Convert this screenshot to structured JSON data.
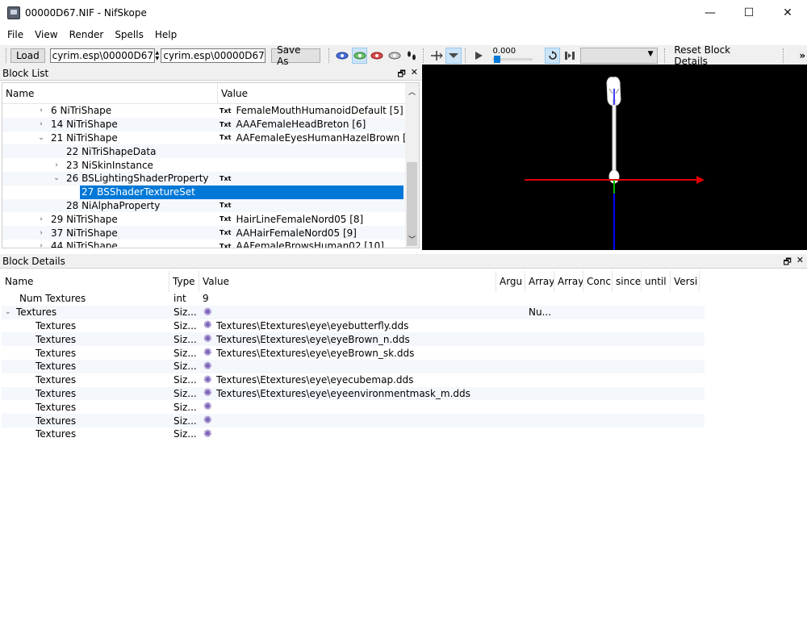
{
  "window": {
    "title": "00000D67.NIF - NifSkope",
    "minimize": "—",
    "maximize": "☐",
    "close": "✕"
  },
  "menu": [
    "File",
    "View",
    "Render",
    "Spells",
    "Help"
  ],
  "toolbar": {
    "load_label": "Load",
    "load_path": "cyrim.esp\\00000D67.NIF",
    "save_path": "cyrim.esp\\00000D67.NIF",
    "save_as_label": "Save As",
    "time_value": "0.000",
    "time_fraction": 0.0,
    "reset_label": "Reset Block Details",
    "overflow": "»"
  },
  "block_list": {
    "title": "Block List",
    "col_name": "Name",
    "col_value": "Value",
    "float_icon": "🗗",
    "close_icon": "✕",
    "txt_tag": "Txt",
    "rows": [
      {
        "chev": ">",
        "name": "6 NiTriShape",
        "value": "FemaleMouthHumanoidDefault [5]",
        "txt": true,
        "indent": 0
      },
      {
        "chev": ">",
        "name": "14 NiTriShape",
        "value": "AAAFemaleHeadBreton [6]",
        "txt": true,
        "indent": 0
      },
      {
        "chev": "v",
        "name": "21 NiTriShape",
        "value": "AAFemaleEyesHumanHazelBrown [...",
        "txt": true,
        "indent": 0
      },
      {
        "chev": "",
        "name": "22 NiTriShapeData",
        "value": "",
        "txt": false,
        "indent": 1
      },
      {
        "chev": ">",
        "name": "23 NiSkinInstance",
        "value": "",
        "txt": false,
        "indent": 1
      },
      {
        "chev": "v",
        "name": "26 BSLightingShaderProperty",
        "value": "",
        "txt": true,
        "indent": 1
      },
      {
        "chev": "",
        "name": "27 BSShaderTextureSet",
        "value": "",
        "txt": false,
        "indent": 2,
        "selected": true
      },
      {
        "chev": "",
        "name": "28 NiAlphaProperty",
        "value": "",
        "txt": true,
        "indent": 1
      },
      {
        "chev": ">",
        "name": "29 NiTriShape",
        "value": "HairLineFemaleNord05 [8]",
        "txt": true,
        "indent": 0
      },
      {
        "chev": ">",
        "name": "37 NiTriShape",
        "value": "AAHairFemaleNord05 [9]",
        "txt": true,
        "indent": 0
      },
      {
        "chev": ">",
        "name": "44 NiTriShape",
        "value": "AAFemaleBrowsHuman02 [10]",
        "txt": true,
        "indent": 0
      }
    ]
  },
  "block_details": {
    "title": "Block Details",
    "float_icon": "🗗",
    "close_icon": "✕",
    "columns": [
      "Name",
      "Type",
      "Value",
      "Argu",
      "Array",
      "Array",
      "Conc",
      "since",
      "until",
      "Versi"
    ],
    "rows": [
      {
        "chev": "",
        "name": "Num Textures",
        "type": "int",
        "value": "9",
        "gear": false,
        "indent": 1,
        "arr": ""
      },
      {
        "chev": "v",
        "name": "Textures",
        "type": "Siz...",
        "value": "",
        "gear": true,
        "indent": 0,
        "arr": "Nu..."
      },
      {
        "chev": "",
        "name": "Textures",
        "type": "Siz...",
        "value": "Textures\\Etextures\\eye\\eyebutterfly.dds",
        "gear": true,
        "indent": 2,
        "arr": ""
      },
      {
        "chev": "",
        "name": "Textures",
        "type": "Siz...",
        "value": "Textures\\Etextures\\eye\\eyeBrown_n.dds",
        "gear": true,
        "indent": 2,
        "arr": ""
      },
      {
        "chev": "",
        "name": "Textures",
        "type": "Siz...",
        "value": "Textures\\Etextures\\eye\\eyeBrown_sk.dds",
        "gear": true,
        "indent": 2,
        "arr": ""
      },
      {
        "chev": "",
        "name": "Textures",
        "type": "Siz...",
        "value": "",
        "gear": true,
        "indent": 2,
        "arr": ""
      },
      {
        "chev": "",
        "name": "Textures",
        "type": "Siz...",
        "value": "Textures\\Etextures\\eye\\eyecubemap.dds",
        "gear": true,
        "indent": 2,
        "arr": ""
      },
      {
        "chev": "",
        "name": "Textures",
        "type": "Siz...",
        "value": "Textures\\Etextures\\eye\\eyeenvironmentmask_m.dds",
        "gear": true,
        "indent": 2,
        "arr": ""
      },
      {
        "chev": "",
        "name": "Textures",
        "type": "Siz...",
        "value": "",
        "gear": true,
        "indent": 2,
        "arr": ""
      },
      {
        "chev": "",
        "name": "Textures",
        "type": "Siz...",
        "value": "",
        "gear": true,
        "indent": 2,
        "arr": ""
      },
      {
        "chev": "",
        "name": "Textures",
        "type": "Siz...",
        "value": "",
        "gear": true,
        "indent": 2,
        "arr": ""
      }
    ]
  },
  "icons": {
    "app": "nifskope-app-icon",
    "gear": "texture-gear-icon"
  },
  "colors": {
    "selection": "#0078d7",
    "axis_x": "#e00000",
    "axis_y": "#00c000",
    "axis_z": "#0000ff",
    "viewport_bg": "#000000"
  }
}
